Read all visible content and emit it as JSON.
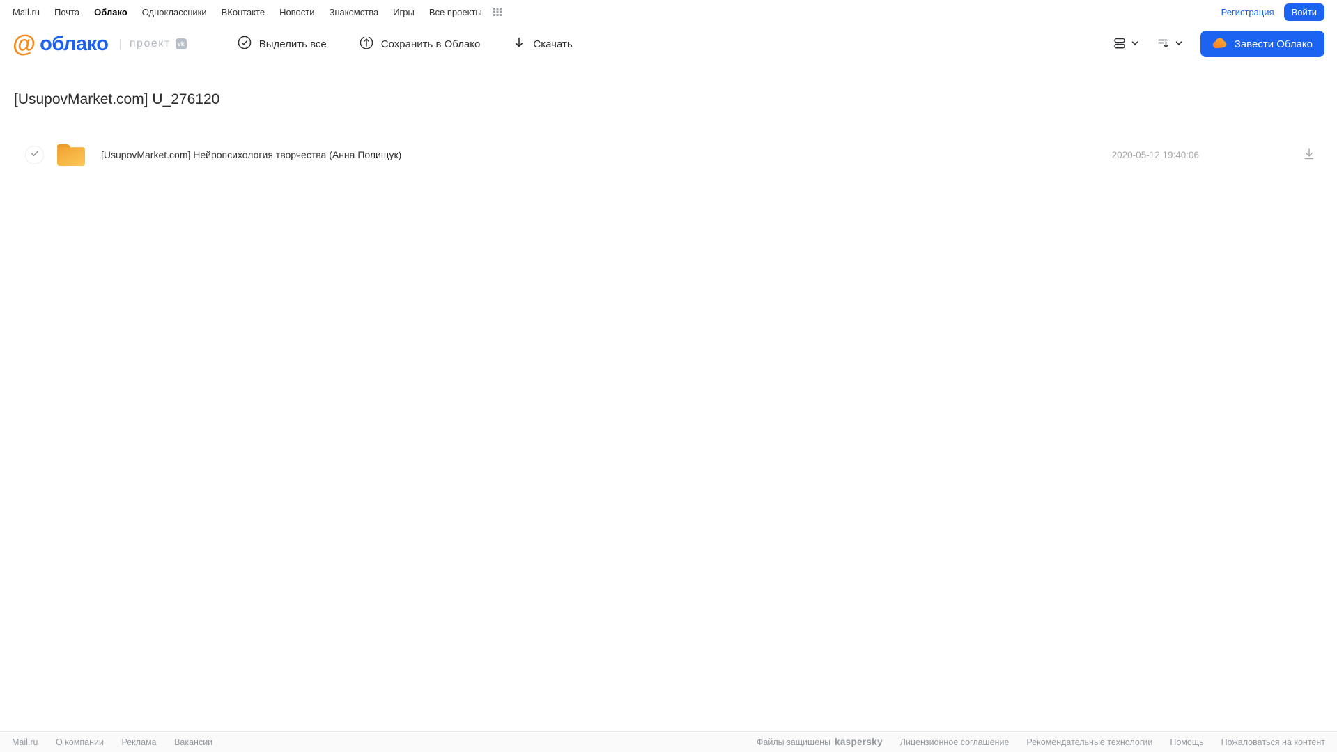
{
  "top_nav": {
    "links": [
      "Mail.ru",
      "Почта",
      "Облако",
      "Одноклассники",
      "ВКонтакте",
      "Новости",
      "Знакомства",
      "Игры",
      "Все проекты"
    ],
    "registration_label": "Регистрация",
    "login_label": "Войти"
  },
  "header": {
    "logo_at": "@",
    "logo_text": "облако",
    "separator": "|",
    "project_label": "проект",
    "vk_badge": "vk",
    "actions": {
      "select_all": "Выделить все",
      "save_to_cloud": "Сохранить в Облако",
      "download": "Скачать"
    },
    "create_cloud_label": "Завести Облако"
  },
  "main": {
    "title": "[UsupovMarket.com] U_276120",
    "files": [
      {
        "name": "[UsupovMarket.com] Нейропсихология творчества (Анна Полищук)",
        "date": "2020-05-12 19:40:06",
        "type": "folder"
      }
    ]
  },
  "footer": {
    "left_links": [
      "Mail.ru",
      "О компании",
      "Реклама",
      "Вакансии"
    ],
    "protected_prefix": "Файлы защищены",
    "kaspersky_label": "kaspersky",
    "right_links": [
      "Лицензионное соглашение",
      "Рекомендательные технологии",
      "Помощь",
      "Пожаловаться на контент"
    ]
  },
  "icons": {
    "all_projects": "grid-dots-icon",
    "select_all": "check-circle-icon",
    "save_to_cloud": "cloud-upload-icon",
    "download": "arrow-down-icon",
    "view_mode": "view-list-icon",
    "sort": "sort-icon",
    "dropdowns": "chevron-down-icon",
    "create_cloud": "cloud-icon",
    "file": "folder-icon",
    "row_select": "check-icon",
    "row_download": "download-icon"
  },
  "colors": {
    "accent_blue": "#1b63f0",
    "logo_orange": "#f78b1e",
    "logo_blue": "#1e62ec",
    "folder_orange": "#f7b13a",
    "kaspersky_green": "#006d5c",
    "muted_gray": "#949aa0"
  }
}
